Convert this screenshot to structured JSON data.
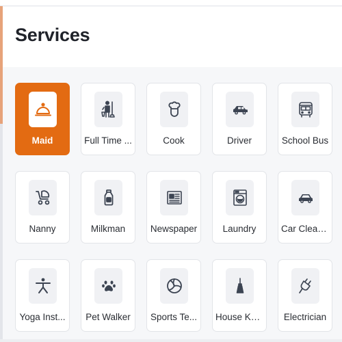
{
  "page": {
    "title": "Services"
  },
  "colors": {
    "accent": "#e36b12",
    "icon": "#3c4452"
  },
  "services": [
    {
      "label": "Maid",
      "icon": "service-bell-icon",
      "selected": true
    },
    {
      "label": "Full Time ...",
      "icon": "janitor-icon",
      "selected": false
    },
    {
      "label": "Cook",
      "icon": "chef-icon",
      "selected": false
    },
    {
      "label": "Driver",
      "icon": "car-icon",
      "selected": false
    },
    {
      "label": "School Bus",
      "icon": "bus-icon",
      "selected": false
    },
    {
      "label": "Nanny",
      "icon": "stroller-icon",
      "selected": false
    },
    {
      "label": "Milkman",
      "icon": "milk-bottle-icon",
      "selected": false
    },
    {
      "label": "Newspaper",
      "icon": "newspaper-icon",
      "selected": false
    },
    {
      "label": "Laundry",
      "icon": "washing-machine-icon",
      "selected": false
    },
    {
      "label": "Car Cleaner",
      "icon": "car-icon",
      "selected": false
    },
    {
      "label": "Yoga Inst...",
      "icon": "yoga-icon",
      "selected": false
    },
    {
      "label": "Pet Walker",
      "icon": "paw-icon",
      "selected": false
    },
    {
      "label": "Sports Te...",
      "icon": "volleyball-icon",
      "selected": false
    },
    {
      "label": "House Ke...",
      "icon": "broom-icon",
      "selected": false
    },
    {
      "label": "Electrician",
      "icon": "plug-icon",
      "selected": false
    }
  ]
}
